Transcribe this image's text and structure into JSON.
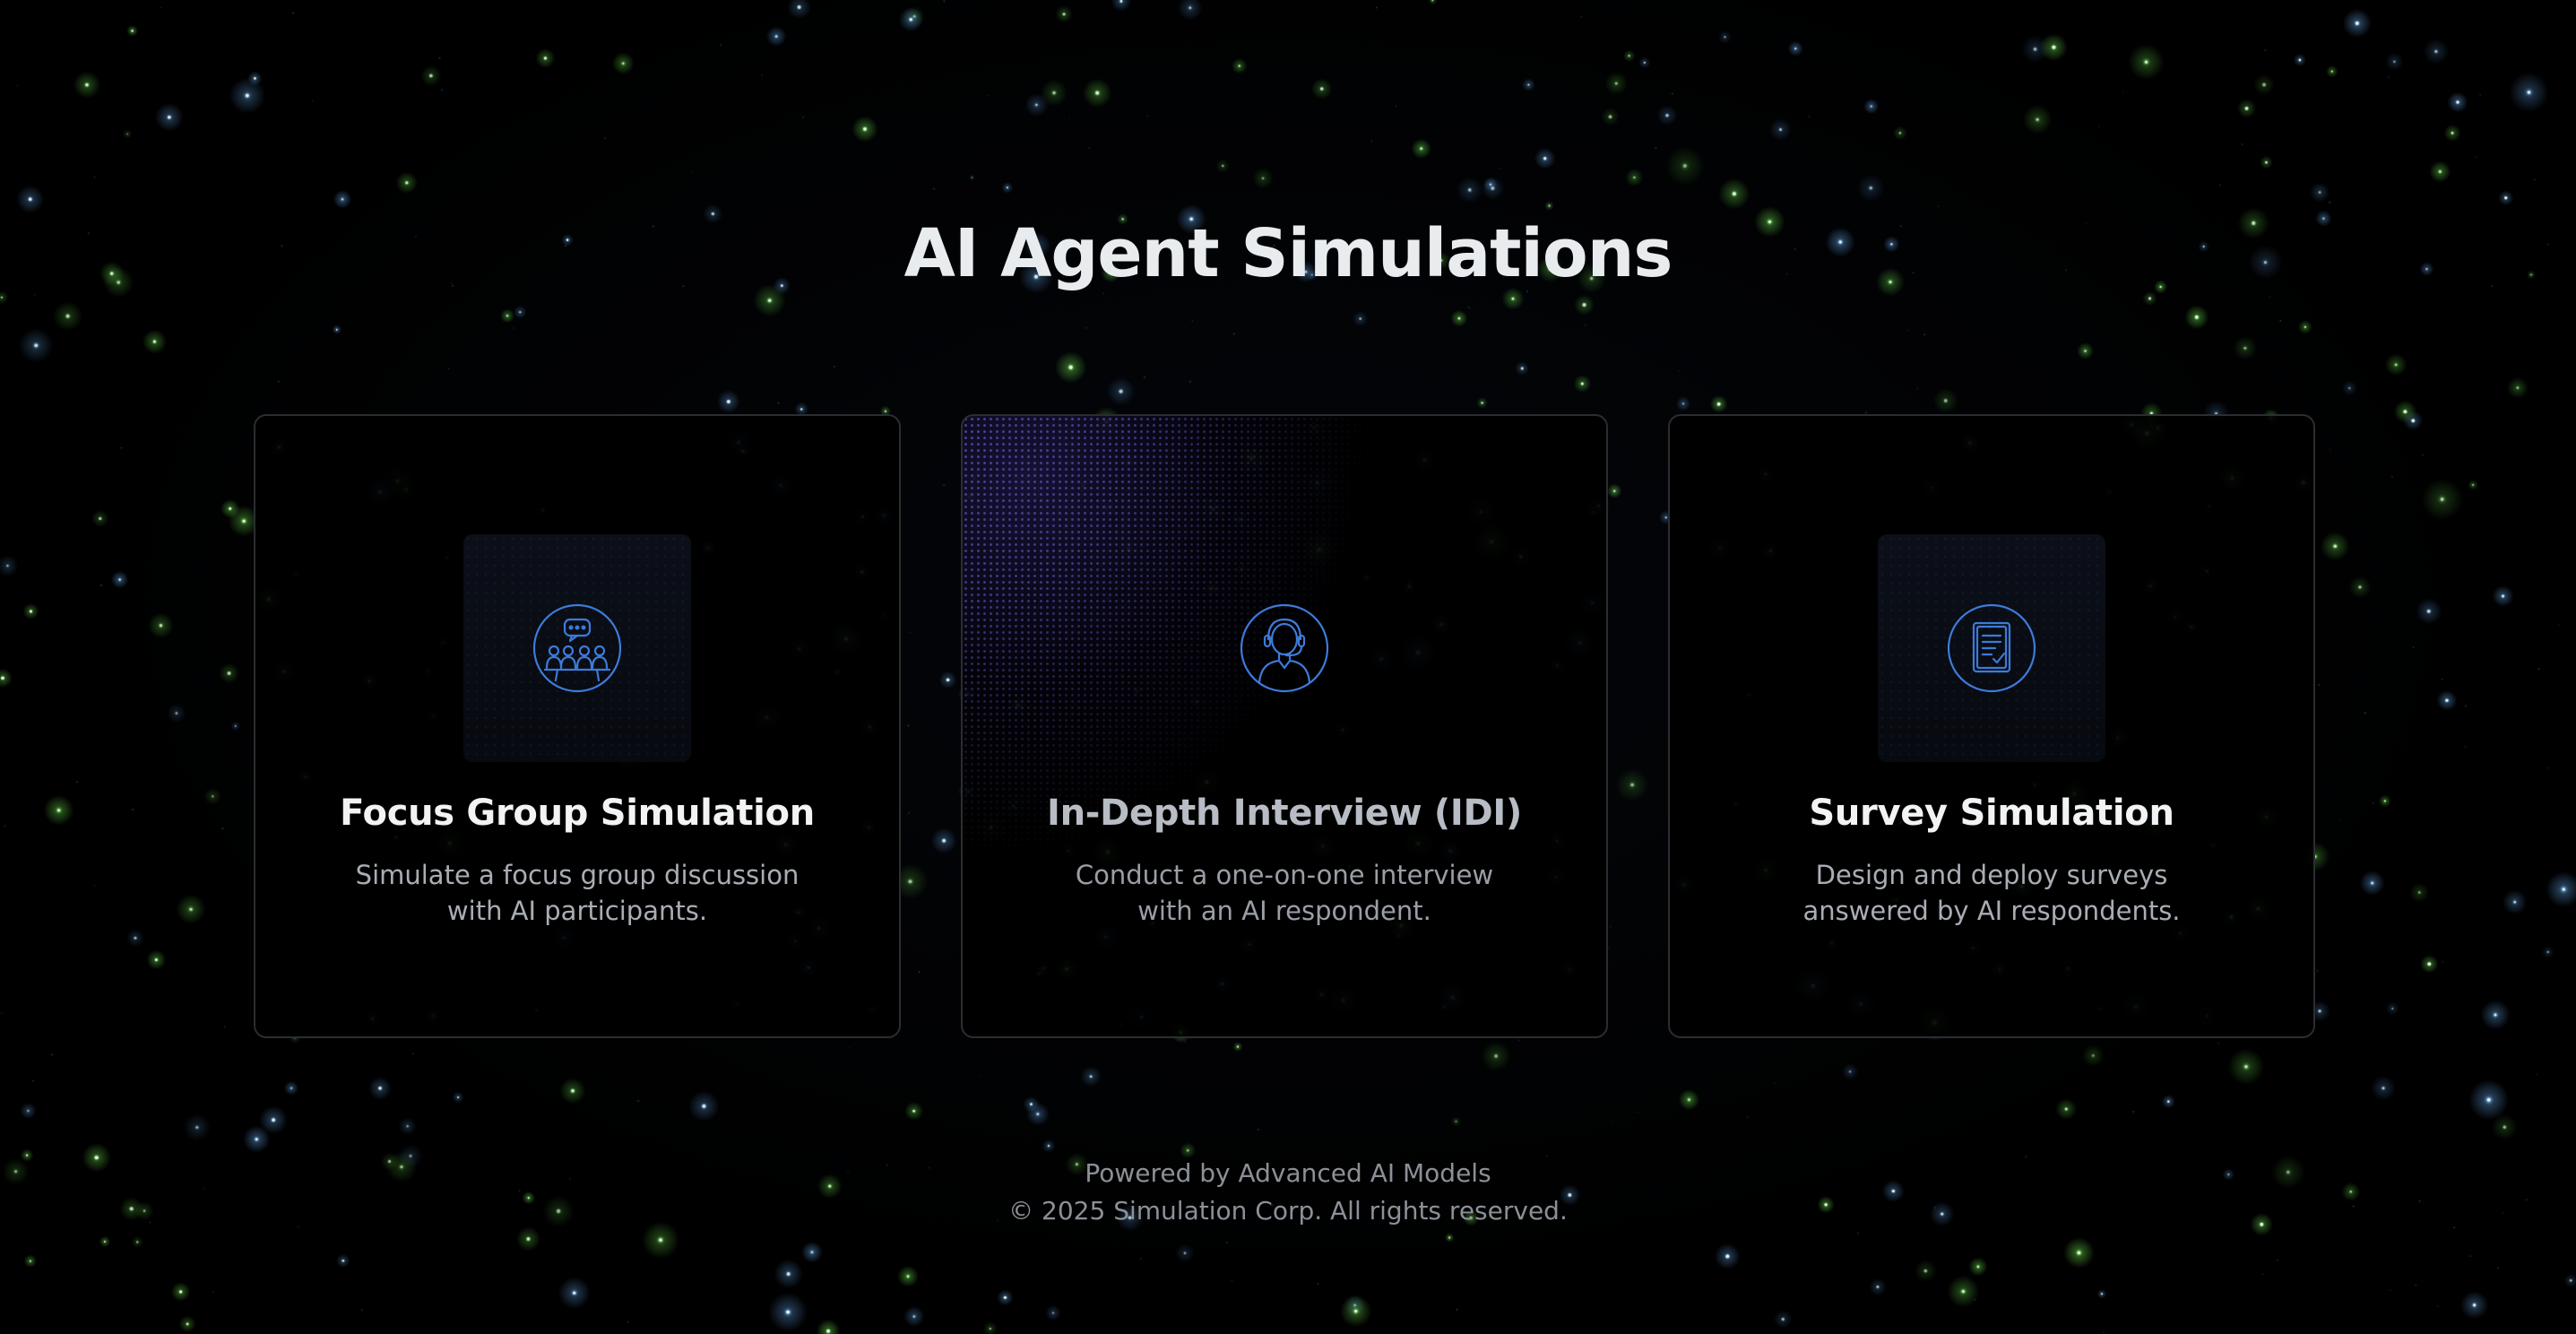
{
  "page": {
    "title": "AI Agent Simulations"
  },
  "cards": [
    {
      "icon": "focus-group-icon",
      "title": "Focus Group Simulation",
      "description": "Simulate a focus group discussion with AI participants."
    },
    {
      "icon": "interview-headset-icon",
      "title": "In-Depth Interview (IDI)",
      "description": "Conduct a one-on-one interview with an AI respondent."
    },
    {
      "icon": "survey-document-icon",
      "title": "Survey Simulation",
      "description": "Design and deploy surveys answered by AI respondents."
    }
  ],
  "footer": {
    "line1": "Powered by Advanced AI Models",
    "line2": "© 2025 Simulation Corp. All rights reserved."
  },
  "colors": {
    "background": "#000000",
    "icon_stroke": "#3d7bd9",
    "star_green": "#7cff5a",
    "star_blue": "#6fb6ff",
    "card_border": "#2b2d31"
  }
}
